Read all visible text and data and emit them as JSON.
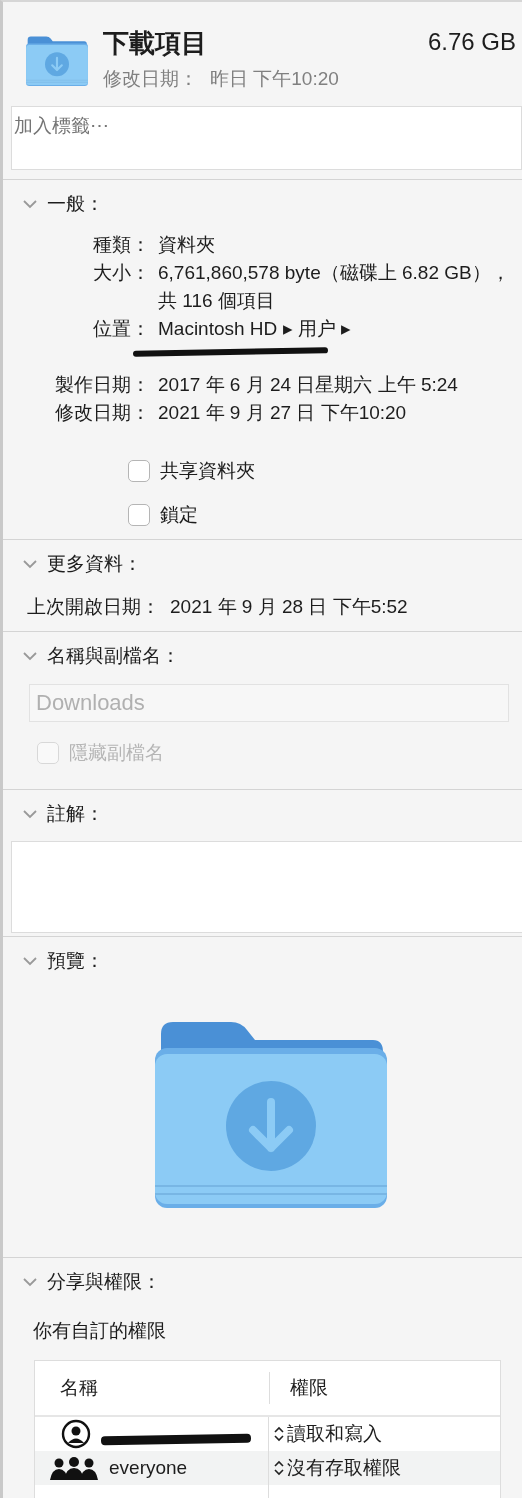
{
  "header": {
    "title": "下載項目",
    "size": "6.76 GB",
    "modified_label": "修改日期：",
    "modified_value": "昨日 下午10:20"
  },
  "tags": {
    "placeholder": "加入標籤⋯"
  },
  "general": {
    "title": "一般：",
    "expanded": true,
    "rows": [
      {
        "label": "種類：",
        "value": "資料夾"
      },
      {
        "label": "大小：",
        "value": "6,761,860,578 byte（磁碟上 6.82 GB），共 116 個項目"
      },
      {
        "label": "位置：",
        "value": "Macintosh HD ▸ 用户 ▸",
        "redacted": true
      },
      {
        "label": "製作日期：",
        "value": "2017 年 6 月 24 日星期六 上午 5:24"
      },
      {
        "label": "修改日期：",
        "value": "2021 年 9 月 27 日 下午10:20"
      }
    ],
    "checkboxes": [
      {
        "label": "共享資料夾",
        "checked": false
      },
      {
        "label": "鎖定",
        "checked": false
      }
    ]
  },
  "more_info": {
    "title": "更多資料：",
    "expanded": true,
    "label": "上次開啟日期：",
    "value": "2021 年 9 月 28 日 下午5:52"
  },
  "name_extension": {
    "title": "名稱與副檔名：",
    "expanded": true,
    "value": "Downloads",
    "disabled": true,
    "hide_extension": {
      "label": "隱藏副檔名",
      "checked": false,
      "disabled": true
    }
  },
  "comments": {
    "title": "註解：",
    "expanded": true
  },
  "preview": {
    "title": "預覽：",
    "expanded": true
  },
  "sharing": {
    "title": "分享與權限：",
    "expanded": true,
    "note": "你有自訂的權限",
    "columns": [
      "名稱",
      "權限"
    ],
    "rows": [
      {
        "kind": "user",
        "redacted": true,
        "privilege": "讀取和寫入"
      },
      {
        "kind": "group",
        "name": "everyone",
        "privilege": "沒有存取權限"
      }
    ]
  }
}
